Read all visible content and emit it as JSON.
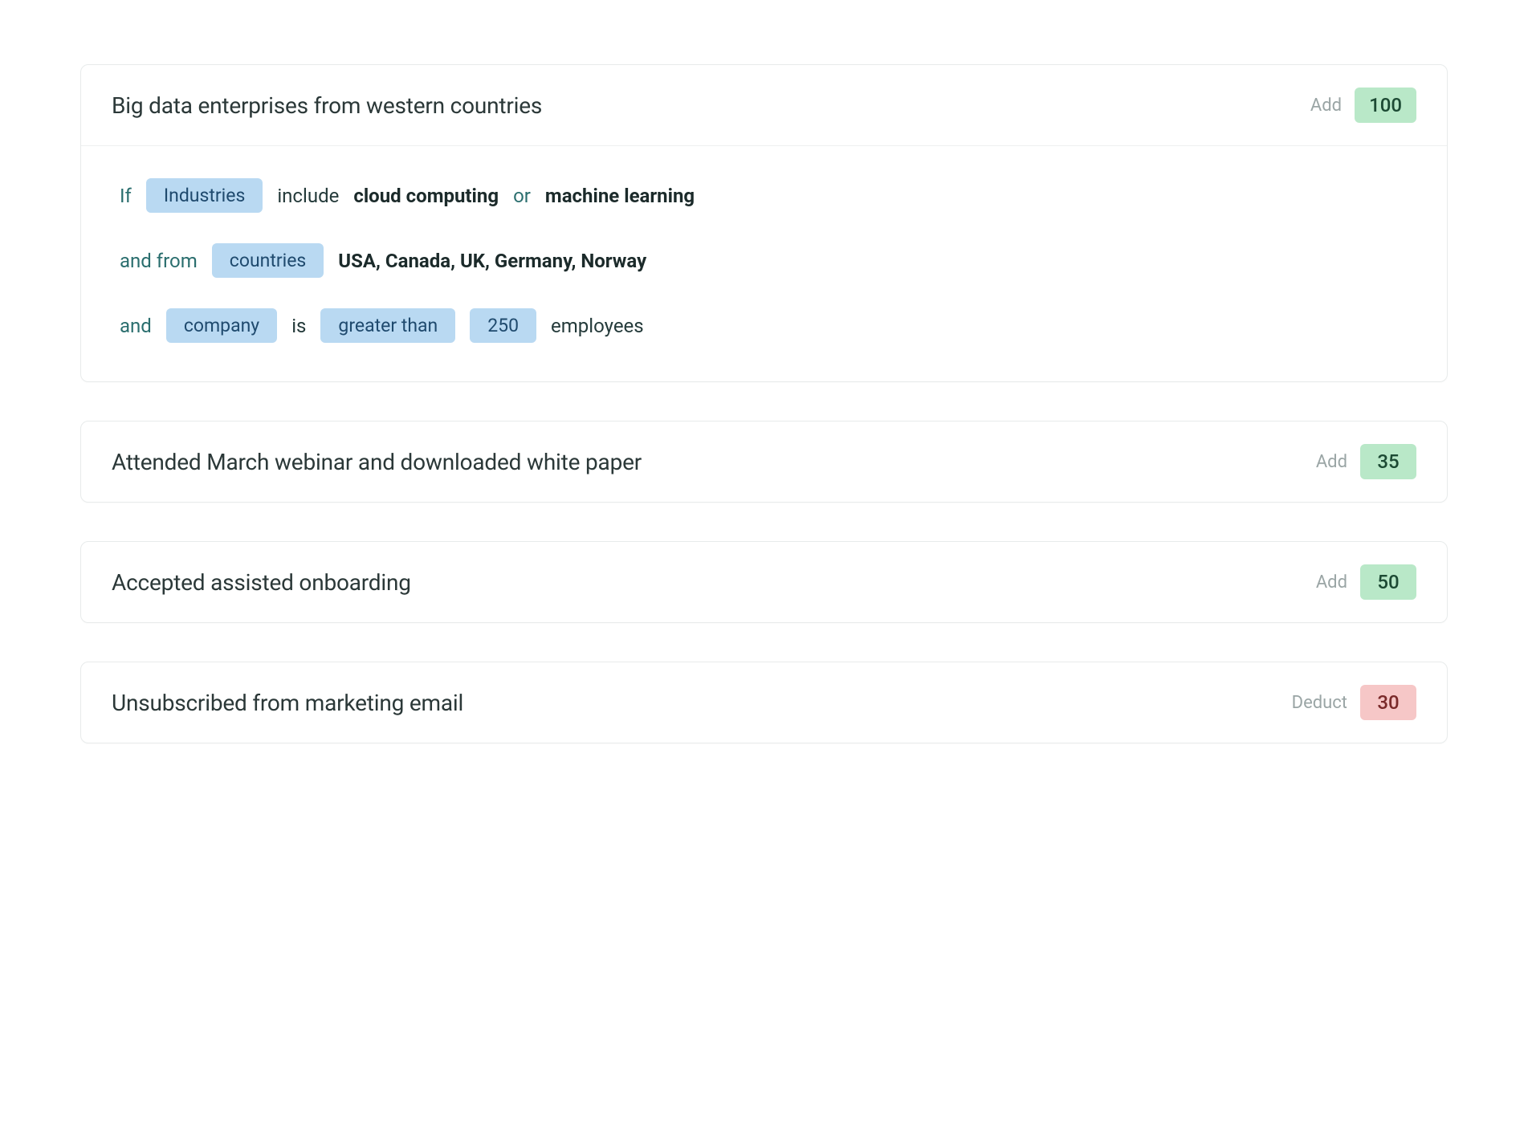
{
  "rules": [
    {
      "title": "Big data enterprises from western countries",
      "action": "Add",
      "score": "100",
      "score_kind": "add",
      "expanded": true,
      "conditions": {
        "line1": {
          "if": "If",
          "pill": "Industries",
          "include": "include",
          "val1": "cloud computing",
          "or": "or",
          "val2": "machine learning"
        },
        "line2": {
          "and_from": "and from",
          "pill": "countries",
          "list": "USA, Canada, UK, Germany, Norway"
        },
        "line3": {
          "and": "and",
          "pill_company": "company",
          "is": "is",
          "pill_gt": "greater than",
          "pill_num": "250",
          "employees": "employees"
        }
      }
    },
    {
      "title": "Attended March webinar and downloaded white paper",
      "action": "Add",
      "score": "35",
      "score_kind": "add",
      "expanded": false
    },
    {
      "title": "Accepted assisted onboarding",
      "action": "Add",
      "score": "50",
      "score_kind": "add",
      "expanded": false
    },
    {
      "title": "Unsubscribed from marketing email",
      "action": "Deduct",
      "score": "30",
      "score_kind": "deduct",
      "expanded": false
    }
  ]
}
